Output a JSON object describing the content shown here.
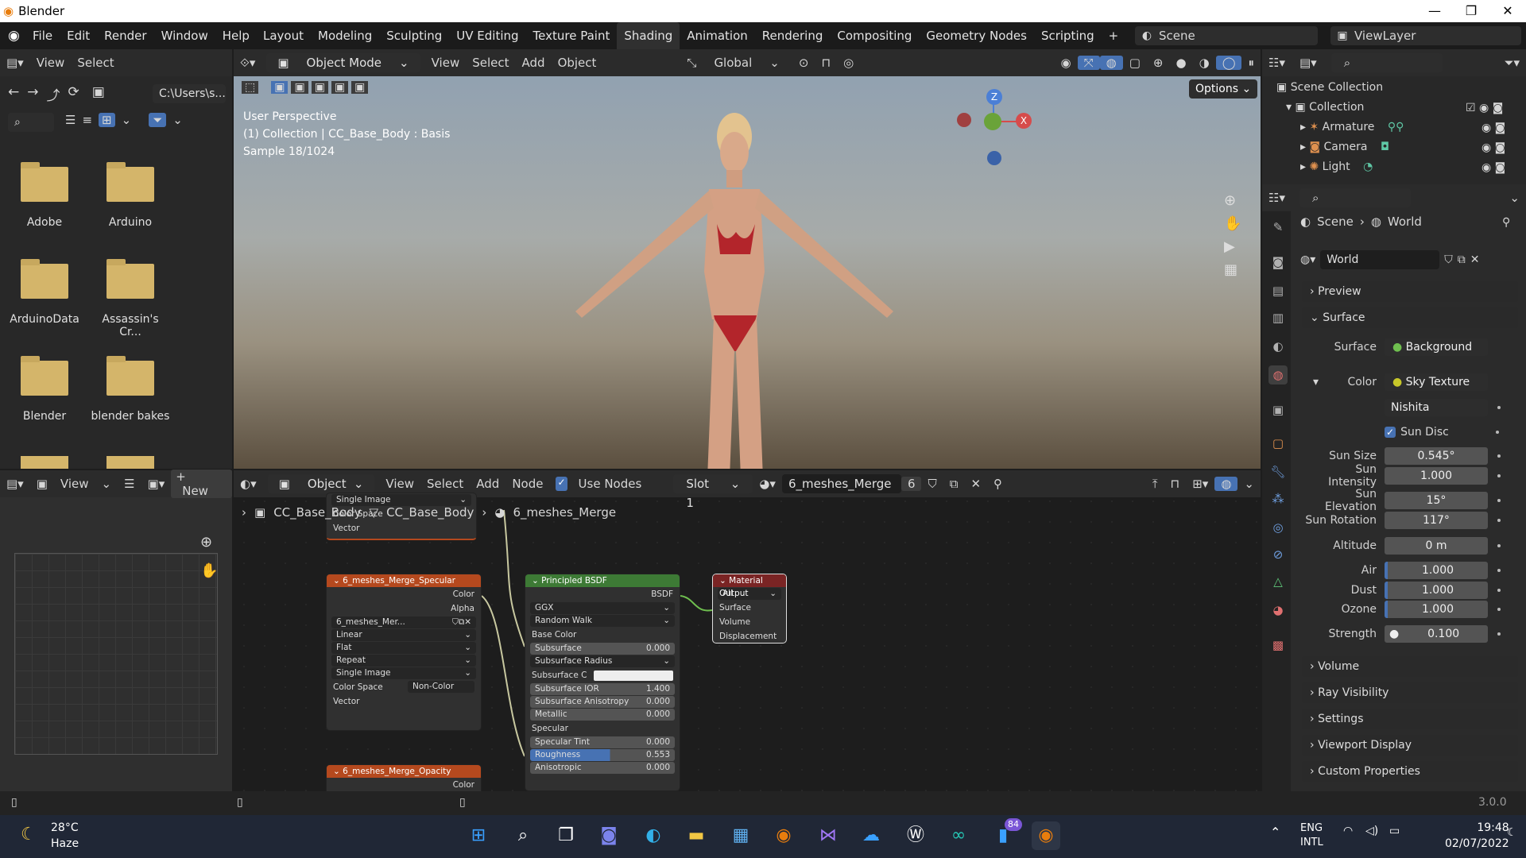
{
  "window": {
    "title": "Blender",
    "min": "—",
    "max": "❐",
    "close": "✕"
  },
  "menu": [
    "File",
    "Edit",
    "Render",
    "Window",
    "Help"
  ],
  "workspaces": [
    "Layout",
    "Modeling",
    "Sculpting",
    "UV Editing",
    "Texture Paint",
    "Shading",
    "Animation",
    "Rendering",
    "Compositing",
    "Geometry Nodes",
    "Scripting",
    "+"
  ],
  "scene": {
    "label": "Scene",
    "viewlayer": "ViewLayer"
  },
  "filebrowser": {
    "menu": [
      "View",
      "Select"
    ],
    "path": "C:\\Users\\s...",
    "folders": [
      "Adobe",
      "Arduino",
      "ArduinoData",
      "Assassin's Cr...",
      "Blender",
      "blender bakes"
    ]
  },
  "viewport": {
    "mode": "Object Mode",
    "menu": [
      "View",
      "Select",
      "Add",
      "Object"
    ],
    "transform": "Global",
    "options": "Options",
    "info1": "User Perspective",
    "info2": "(1) Collection | CC_Base_Body : Basis",
    "info3": "Sample 18/1024",
    "gizmo": {
      "z": "Z",
      "x": "X"
    }
  },
  "outliner": {
    "title": "Scene Collection",
    "collection": "Collection",
    "items": [
      "Armature",
      "Camera",
      "Light"
    ]
  },
  "props": {
    "breadcrumb1": "Scene",
    "breadcrumb2": "World",
    "world": "World",
    "preview": "Preview",
    "surface_section": "Surface",
    "surface_lbl": "Surface",
    "surface_val": "Background",
    "color_lbl": "Color",
    "color_val": "Sky Texture",
    "sky_type": "Nishita",
    "sun_disc": "Sun Disc",
    "sun_size_lbl": "Sun Size",
    "sun_size": "0.545°",
    "sun_int_lbl": "Sun Intensity",
    "sun_int": "1.000",
    "sun_elev_lbl": "Sun Elevation",
    "sun_elev": "15°",
    "sun_rot_lbl": "Sun Rotation",
    "sun_rot": "117°",
    "alt_lbl": "Altitude",
    "alt": "0 m",
    "air_lbl": "Air",
    "air": "1.000",
    "dust_lbl": "Dust",
    "dust": "1.000",
    "ozone_lbl": "Ozone",
    "ozone": "1.000",
    "strength_lbl": "Strength",
    "strength": "0.100",
    "sections": [
      "Volume",
      "Ray Visibility",
      "Settings",
      "Viewport Display",
      "Custom Properties"
    ]
  },
  "imageeditor": {
    "view": "View",
    "new": "New"
  },
  "nodeeditor": {
    "object": "Object",
    "menu": [
      "View",
      "Select",
      "Add",
      "Node"
    ],
    "use_nodes": "Use Nodes",
    "slot": "Slot 1",
    "material": "6_meshes_Merge",
    "users": "6",
    "bc1": "CC_Base_Body",
    "bc2": "CC_Base_Body",
    "bc3": "6_meshes_Merge"
  },
  "nodes": {
    "top": {
      "row1": "Single Image",
      "row2": "Color Space",
      "row3": "Vector"
    },
    "spec": {
      "title": "6_meshes_Merge_Specular",
      "color": "Color",
      "alpha": "Alpha",
      "img": "6_meshes_Mer...",
      "interp": "Linear",
      "proj": "Flat",
      "ext": "Repeat",
      "src": "Single Image",
      "cs_lbl": "Color Space",
      "cs": "Non-Color",
      "vector": "Vector"
    },
    "opacity": {
      "title": "6_meshes_Merge_Opacity",
      "color": "Color"
    },
    "bsdf": {
      "title": "Principled BSDF",
      "out": "BSDF",
      "dist": "GGX",
      "sss_method": "Random Walk",
      "base": "Base Color",
      "sub": "Subsurface",
      "sub_v": "0.000",
      "subrad": "Subsurface Radius",
      "subc": "Subsurface C",
      "subior": "Subsurface IOR",
      "subior_v": "1.400",
      "subaniso": "Subsurface Anisotropy",
      "subaniso_v": "0.000",
      "metal": "Metallic",
      "metal_v": "0.000",
      "spec": "Specular",
      "spectint": "Specular Tint",
      "spectint_v": "0.000",
      "rough": "Roughness",
      "rough_v": "0.553",
      "aniso": "Anisotropic",
      "aniso_v": "0.000"
    },
    "out": {
      "title": "Material Output",
      "target": "All",
      "surface": "Surface",
      "volume": "Volume",
      "disp": "Displacement"
    }
  },
  "status": {
    "version": "3.0.0"
  },
  "taskbar": {
    "temp": "28°C",
    "weather": "Haze",
    "lang1": "ENG",
    "lang2": "INTL",
    "time": "19:48",
    "date": "02/07/2022",
    "badge": "84"
  },
  "colors": {
    "accent": "#4772b3",
    "active_tab": "#303030",
    "node_bsdf": "#3d7a35",
    "node_tex": "#b5491e",
    "node_out": "#7a2424"
  }
}
